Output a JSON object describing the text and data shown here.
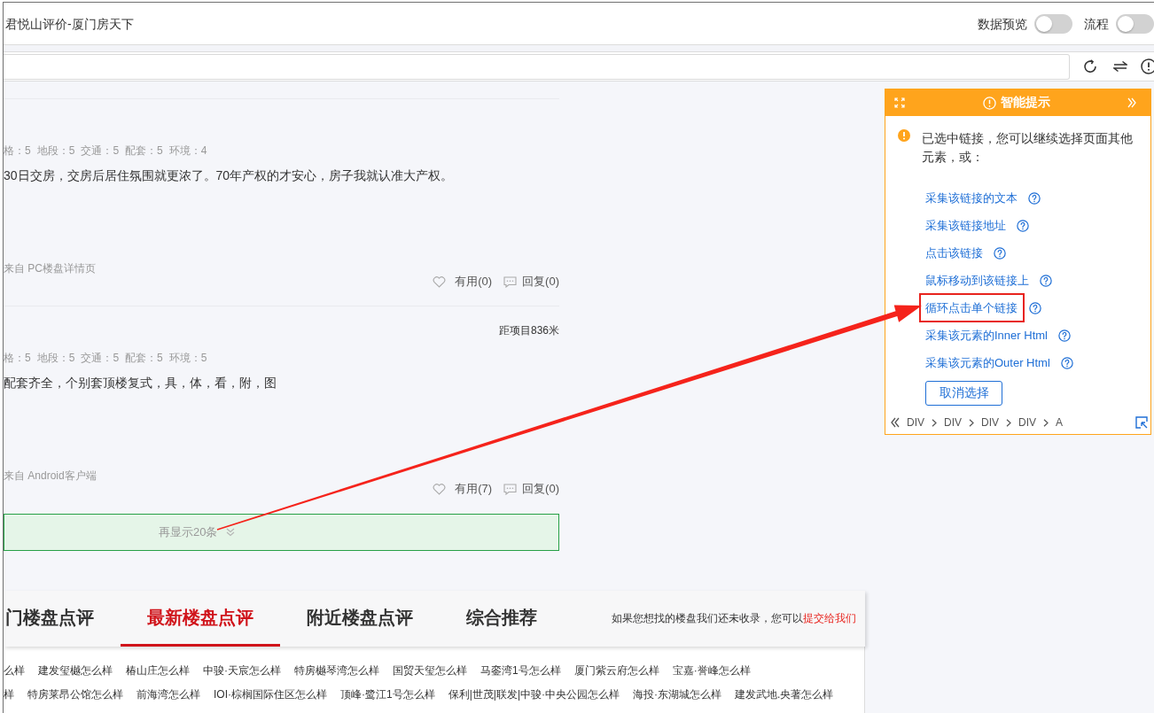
{
  "window": {
    "title": "君悦山评价-厦门房天下"
  },
  "toolbar": {
    "toggles": [
      {
        "label": "数据预览",
        "on": false
      },
      {
        "label": "流程",
        "on": false
      }
    ]
  },
  "reviews": [
    {
      "ratings": [
        "格：5",
        "地段：5",
        "交通：5",
        "配套：5",
        "环境：4"
      ],
      "text": "30日交房，交房后居住氛围就更浓了。70年产权的才安心，房子我就认准大产权。",
      "source": "来自 PC楼盘详情页",
      "useful": "有用(0)",
      "reply": "回复(0)"
    },
    {
      "distance": "距项目836米",
      "ratings": [
        "格：5",
        "地段：5",
        "交通：5",
        "配套：5",
        "环境：5"
      ],
      "text": "配套齐全，个别套顶楼复式，具，体，看，附，图",
      "source": "来自 Android客户端",
      "useful": "有用(7)",
      "reply": "回复(0)"
    }
  ],
  "show_more": "再显示20条",
  "hint_panel": {
    "title": "智能提示",
    "message": "已选中链接，您可以继续选择页面其他元素，或：",
    "options": [
      {
        "label": "采集该链接的文本",
        "highlighted": false
      },
      {
        "label": "采集该链接地址",
        "highlighted": false
      },
      {
        "label": "点击该链接",
        "highlighted": false
      },
      {
        "label": "鼠标移动到该链接上",
        "highlighted": false
      },
      {
        "label": "循环点击单个链接",
        "highlighted": true
      },
      {
        "label": "采集该元素的Inner Html",
        "highlighted": false
      },
      {
        "label": "采集该元素的Outer Html",
        "highlighted": false
      }
    ],
    "cancel_button": "取消选择",
    "breadcrumb": [
      "DIV",
      "DIV",
      "DIV",
      "DIV",
      "A"
    ]
  },
  "bottom_tabs": {
    "tabs": [
      {
        "label": "门楼盘点评",
        "selected": false
      },
      {
        "label": "最新楼盘点评",
        "selected": true
      },
      {
        "label": "附近楼盘点评",
        "selected": false
      },
      {
        "label": "综合推荐",
        "selected": false
      }
    ],
    "note": "如果您想找的楼盘我们还未收录，您可以",
    "note_link": "提交给我们"
  },
  "link_rows": [
    [
      "么样",
      "建发玺樾怎么样",
      "椿山庄怎么样",
      "中骏·天宸怎么样",
      "特房樾琴湾怎么样",
      "国贸天玺怎么样",
      "马銮湾1号怎么样",
      "厦门紫云府怎么样",
      "宝嘉·誉峰怎么样"
    ],
    [
      "样",
      "特房莱昂公馆怎么样",
      "前海湾怎么样",
      "IOI·棕榈国际住区怎么样",
      "顶峰·鹭江1号怎么样",
      "保利|世茂|联发|中骏·中央公园怎么样",
      "海投·东湖城怎么样",
      "建发武地.央著怎么样"
    ]
  ]
}
